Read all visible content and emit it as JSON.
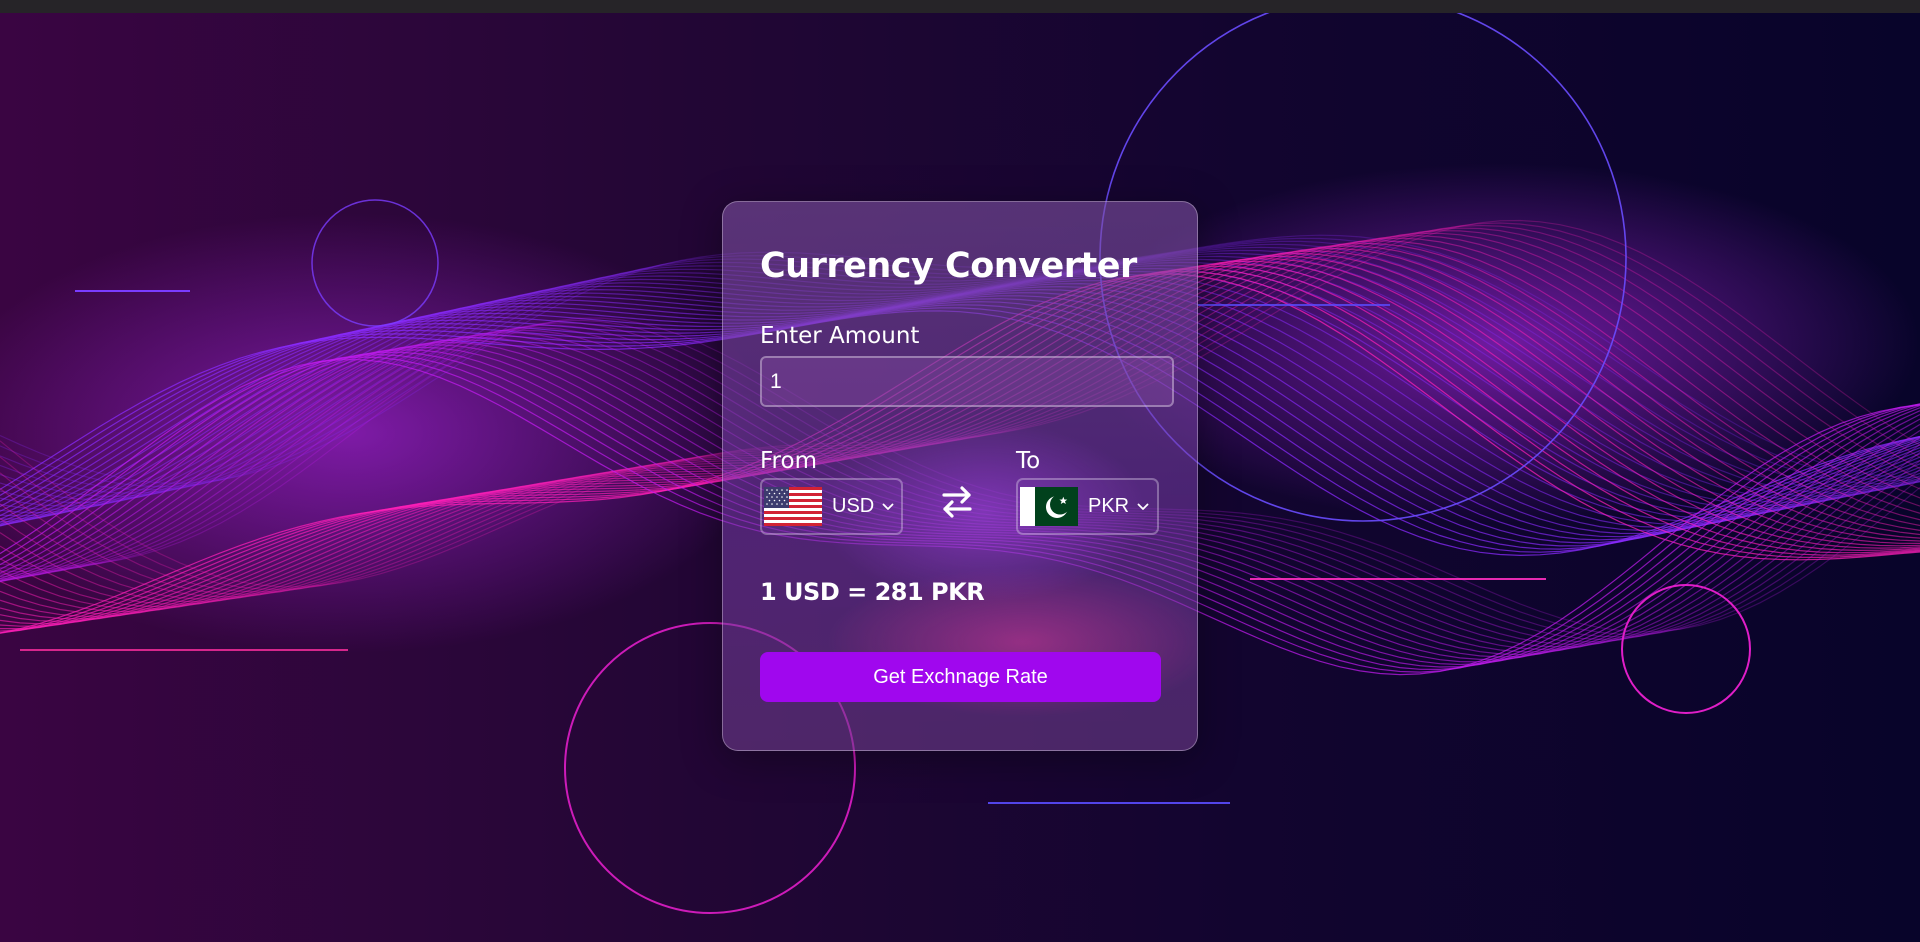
{
  "converter": {
    "title": "Currency Converter",
    "amount_label": "Enter Amount",
    "amount_value": "1",
    "from_label": "From",
    "to_label": "To",
    "from_currency": "USD",
    "to_currency": "PKR",
    "from_flag": "us-flag",
    "to_flag": "pk-flag",
    "result": "1 USD = 281 PKR",
    "button_label": "Get Exchnage Rate"
  },
  "colors": {
    "button": "#a007ee",
    "accent_pink": "#ff1fb8",
    "accent_blue": "#6a3cff"
  },
  "icons": {
    "swap": "swap-arrows-icon",
    "dropdown": "chevron-down-icon"
  }
}
